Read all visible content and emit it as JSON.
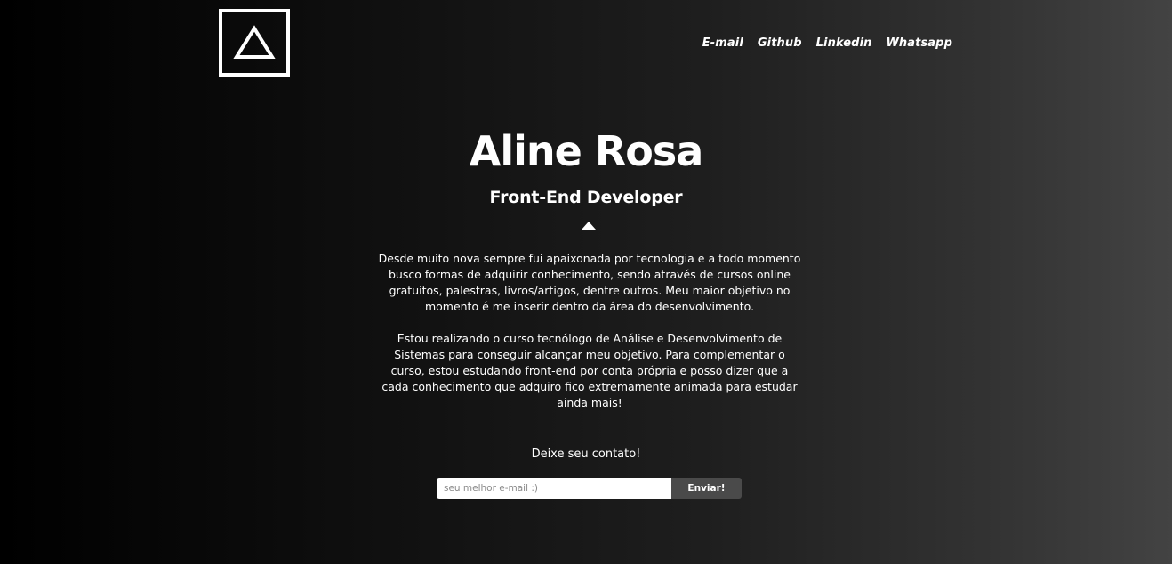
{
  "header": {
    "logo_icon": "triangle-icon",
    "nav": [
      {
        "label": "E-mail"
      },
      {
        "label": "Github"
      },
      {
        "label": "Linkedin"
      },
      {
        "label": "Whatsapp"
      }
    ]
  },
  "hero": {
    "name": "Aline Rosa",
    "role": "Front-End Developer",
    "divider_icon": "arrow-up-icon"
  },
  "about": {
    "paragraphs": [
      "Desde muito nova sempre fui apaixonada por tecnologia e a todo momento busco formas de adquirir conhecimento, sendo através de cursos online gratuitos, palestras, livros/artigos, dentre outros. Meu maior objetivo no momento é me inserir dentro da área do desenvolvimento.",
      "Estou realizando o curso tecnólogo de Análise e Desenvolvimento de Sistemas para conseguir alcançar meu objetivo. Para complementar o curso, estou estudando front-end por conta própria e posso dizer que a cada conhecimento que adquiro fico extremamente animada para estudar ainda mais!"
    ]
  },
  "contact": {
    "prompt": "Deixe seu contato!",
    "email_placeholder": "seu melhor e-mail :)",
    "email_value": "",
    "submit_label": "Enviar!"
  },
  "colors": {
    "background_start": "#000000",
    "background_end": "#434343",
    "text": "#ffffff",
    "button": "#4a4a4a"
  }
}
